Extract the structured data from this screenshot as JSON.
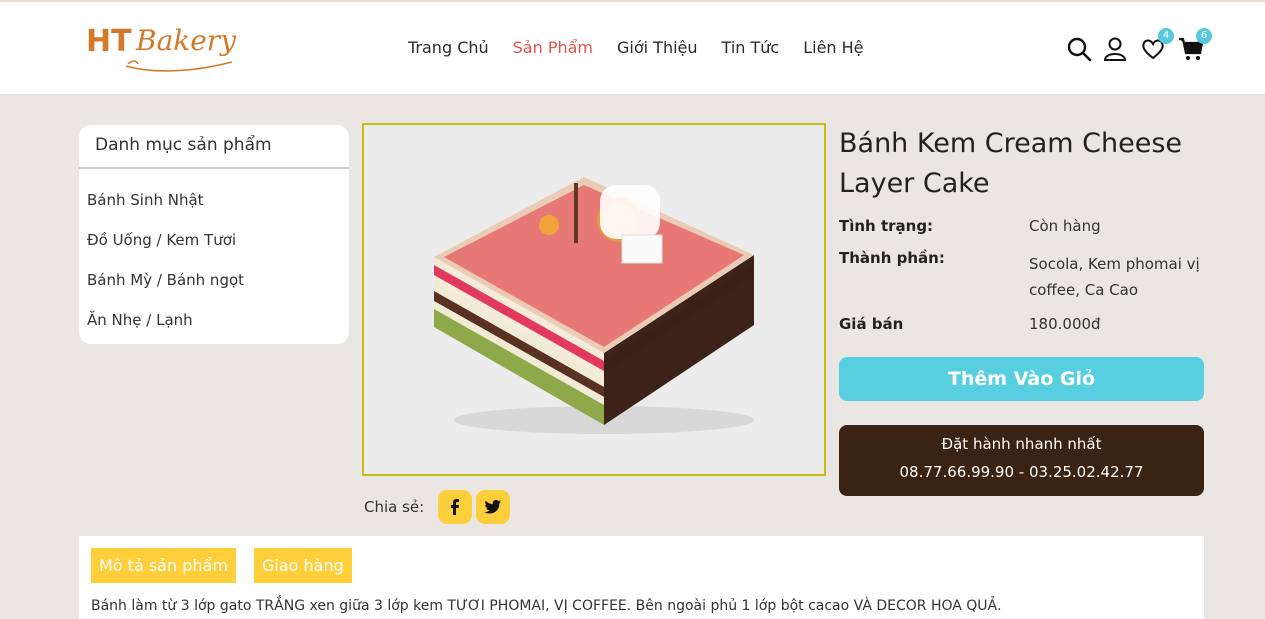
{
  "logo": {
    "ht": "HT",
    "bakery": "Bakery"
  },
  "nav": {
    "items": [
      "Trang Chủ",
      "Sản Phẩm",
      "Giới Thiệu",
      "Tin Tức",
      "Liên Hệ"
    ],
    "active_index": 1
  },
  "header_icons": {
    "search": "search-icon",
    "user": "user-icon",
    "wishlist": "heart-icon",
    "wishlist_count": "4",
    "cart": "cart-icon",
    "cart_count": "6"
  },
  "sidebar": {
    "title": "Danh mục sản phẩm",
    "items": [
      "Bánh Sinh Nhật",
      "Đồ Uống / Kem Tươi",
      "Bánh Mỳ / Bánh ngọt",
      "Ăn Nhẹ / Lạnh"
    ]
  },
  "share": {
    "label": "Chia sẻ:",
    "facebook": "facebook-icon",
    "twitter": "twitter-icon"
  },
  "product": {
    "title_line1": "Bánh Kem Cream Cheese",
    "title_line2": "Layer Cake",
    "status_label": "Tình trạng:",
    "status_value": "Còn hàng",
    "ingredients_label": "Thành phần:",
    "ingredients_value": "Socola, Kem phomai vị coffee, Ca Cao",
    "price_label": "Giá bán",
    "price_value": "180.000đ",
    "add_to_cart": "Thêm Vào Giỏ",
    "hotline_title": "Đặt hành nhanh nhất",
    "hotline_numbers": "08.77.66.99.90 - 03.25.02.42.77"
  },
  "tabs": [
    "Mô tả sản phẩm",
    "Giao hàng"
  ],
  "description": "Bánh làm từ 3 lớp gato TRẮNG xen giữa 3 lớp kem TƯƠI PHOMAI, VỊ COFFEE. Bên ngoài phủ 1 lớp bột cacao VÀ DECOR HOA QUẢ.",
  "colors": {
    "brand": "#d27a2a",
    "active_nav": "#e0524a",
    "cart_button": "#58cfe0",
    "hotline_bg": "#3a2313",
    "tab_bg": "#fecf3b"
  }
}
